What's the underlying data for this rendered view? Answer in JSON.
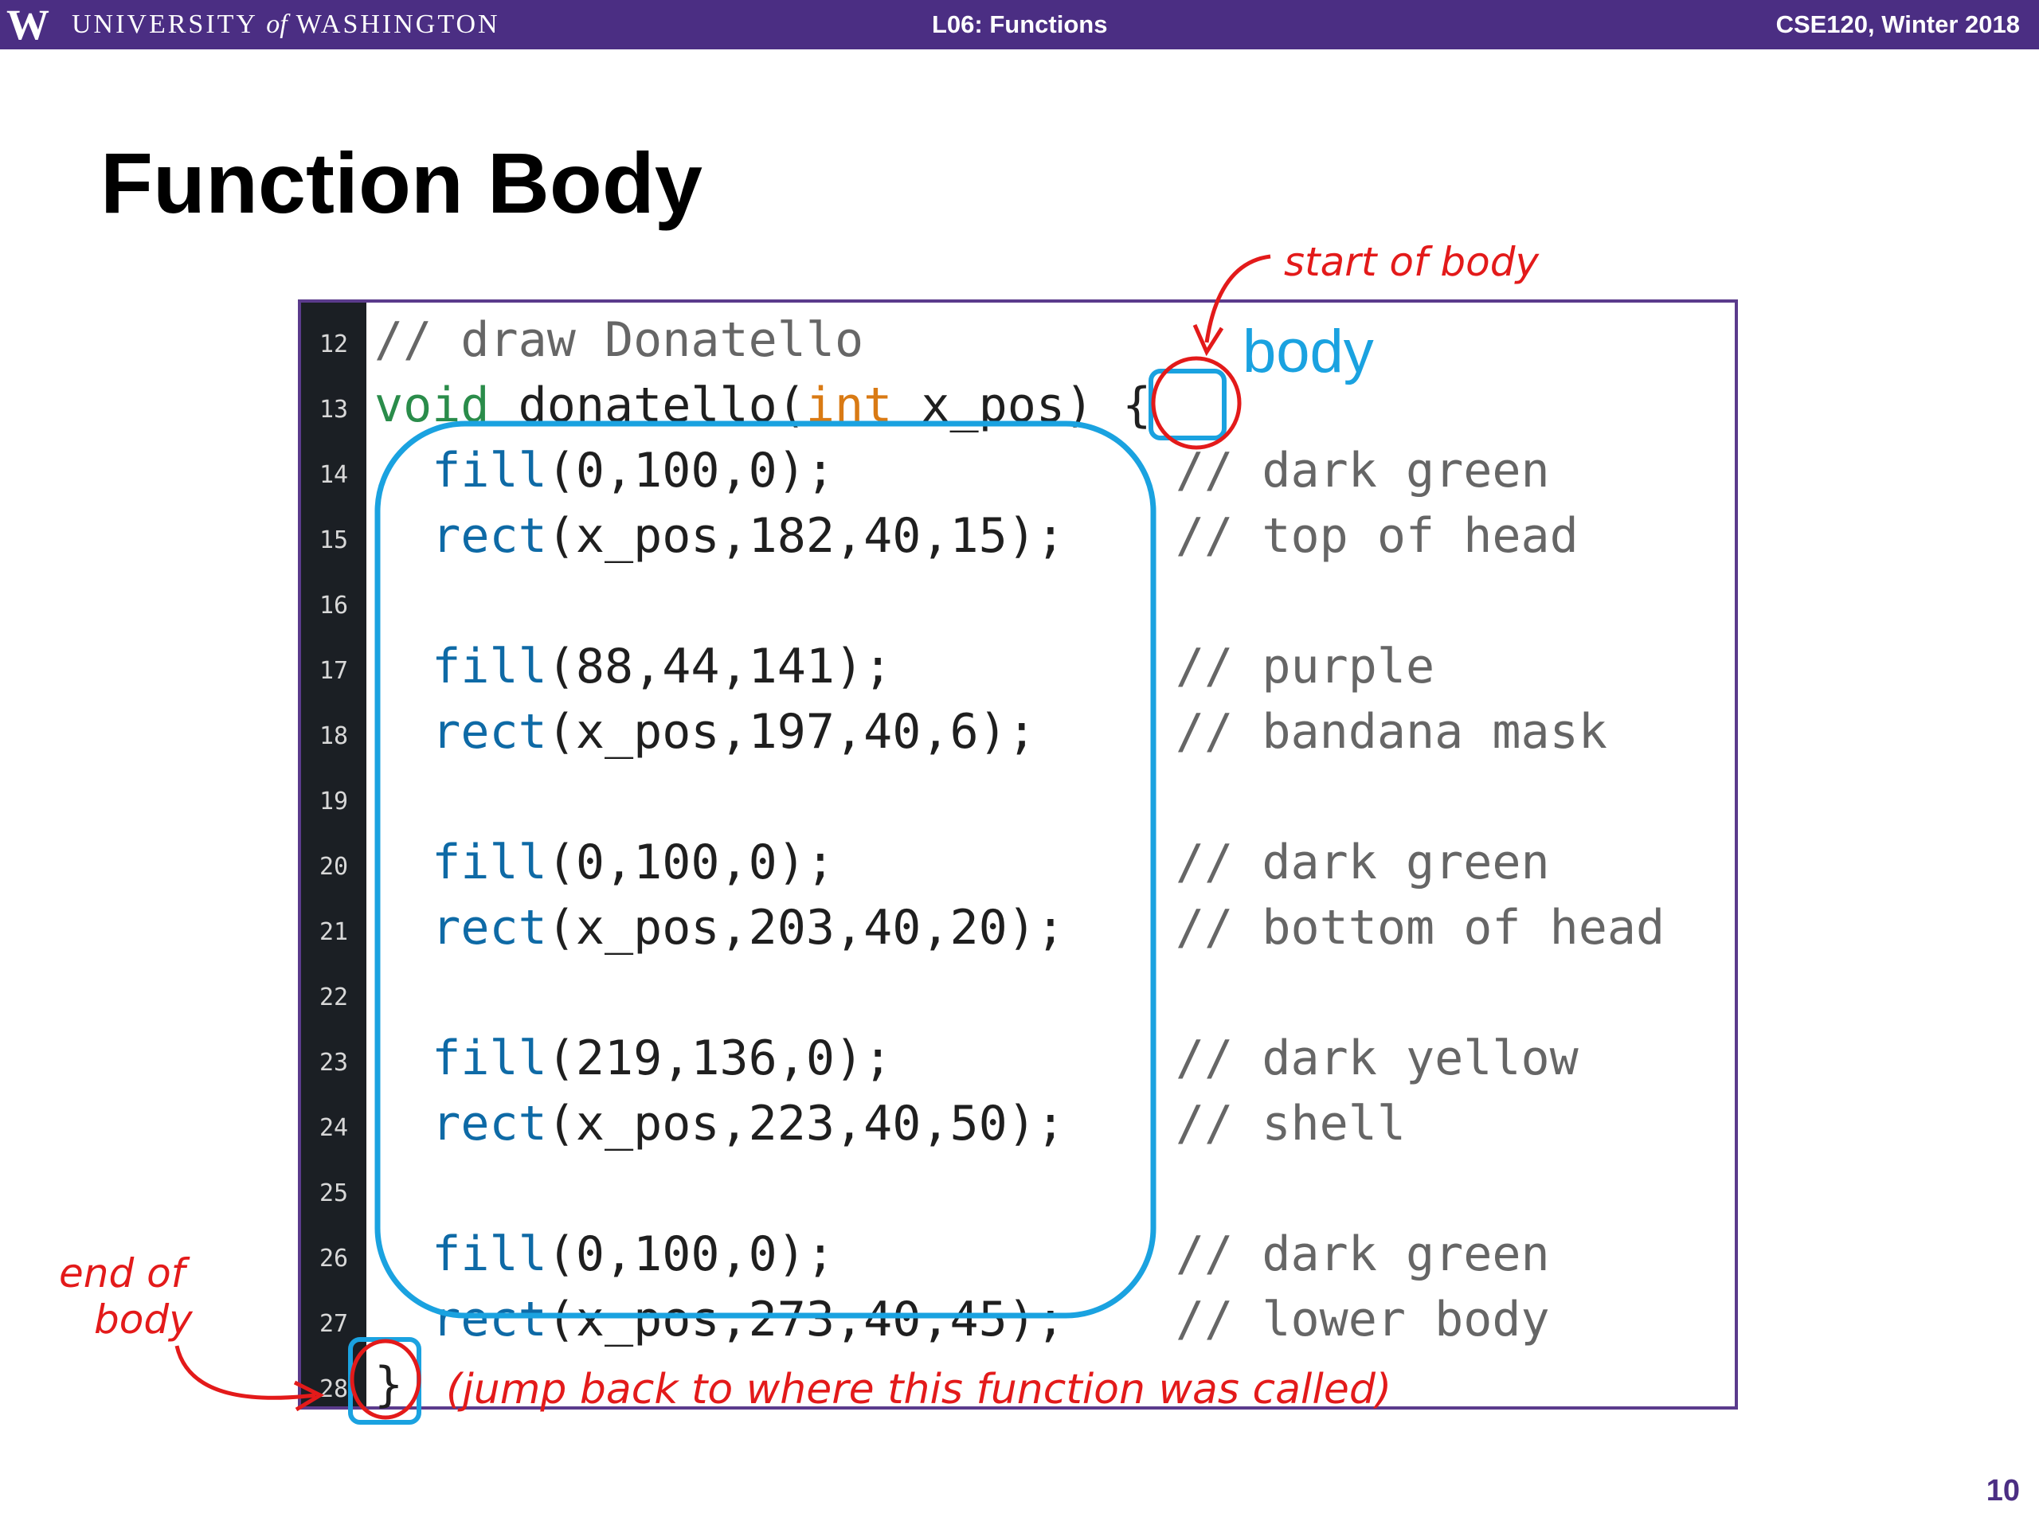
{
  "header": {
    "logo": "W",
    "university": "UNIVERSITY of WASHINGTON",
    "university_pre": "UNIVERSITY",
    "university_of": "of",
    "university_post": "WASHINGTON",
    "lecture": "L06: Functions",
    "course": "CSE120, Winter 2018"
  },
  "slide": {
    "title": "Function Body",
    "page_number": "10"
  },
  "code": {
    "lines": [
      {
        "num": "12",
        "comment": ""
      },
      {
        "num": "13",
        "comment": ""
      },
      {
        "num": "14",
        "comment": "// dark green"
      },
      {
        "num": "15",
        "comment": "// top of head"
      },
      {
        "num": "16",
        "comment": ""
      },
      {
        "num": "17",
        "comment": "// purple"
      },
      {
        "num": "18",
        "comment": "// bandana mask"
      },
      {
        "num": "19",
        "comment": ""
      },
      {
        "num": "20",
        "comment": "// dark green"
      },
      {
        "num": "21",
        "comment": "// bottom of head"
      },
      {
        "num": "22",
        "comment": ""
      },
      {
        "num": "23",
        "comment": "// dark yellow"
      },
      {
        "num": "24",
        "comment": "// shell"
      },
      {
        "num": "25",
        "comment": ""
      },
      {
        "num": "26",
        "comment": "// dark green"
      },
      {
        "num": "27",
        "comment": "// lower body"
      },
      {
        "num": "28",
        "comment": ""
      }
    ],
    "line12": {
      "text": "// draw Donatello"
    },
    "line13": {
      "kw": "void",
      "name": "donatello",
      "paren_open": "(",
      "type": "int",
      "param": " x_pos)",
      "brace": "{"
    },
    "line14": {
      "fn": "fill",
      "args": "(0,100,0);"
    },
    "line15": {
      "fn": "rect",
      "args": "(x_pos,182,40,15);"
    },
    "line17": {
      "fn": "fill",
      "args": "(88,44,141);"
    },
    "line18": {
      "fn": "rect",
      "args": "(x_pos,197,40,6);"
    },
    "line20": {
      "fn": "fill",
      "args": "(0,100,0);"
    },
    "line21": {
      "fn": "rect",
      "args": "(x_pos,203,40,20);"
    },
    "line23": {
      "fn": "fill",
      "args": "(219,136,0);"
    },
    "line24": {
      "fn": "rect",
      "args": "(x_pos,223,40,50);"
    },
    "line26": {
      "fn": "fill",
      "args": "(0,100,0);"
    },
    "line27": {
      "fn": "rect",
      "args": "(x_pos,273,40,45);"
    },
    "line28": {
      "brace": "}"
    }
  },
  "annotations": {
    "body_label": "body",
    "start_of_body": "start of body",
    "end_of_body_1": "end of",
    "end_of_body_2": "body",
    "jump_back": "(jump back to where this function was called)"
  },
  "colors": {
    "banner": "#4b2e83",
    "highlight_blue": "#1aa2e0",
    "annotation_red": "#e31a1a",
    "keyword_green": "#2a8c4a",
    "type_orange": "#d97a14",
    "function_blue": "#0e6aa6"
  }
}
